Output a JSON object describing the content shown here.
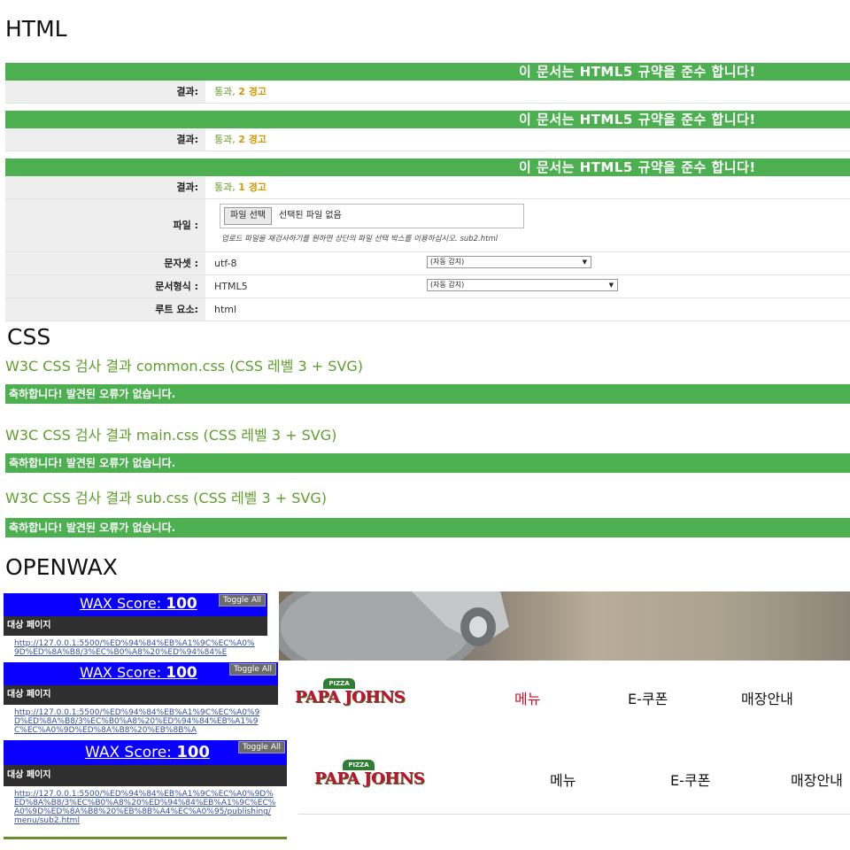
{
  "sections": {
    "html": "HTML",
    "css": "CSS",
    "openwax": "OPENWAX"
  },
  "html_validator": {
    "banner": "이 문서는 HTML5 규약을 준수 합니다!",
    "results": [
      {
        "label": "결과:",
        "pass": "통과,",
        "warn": "2 경고"
      },
      {
        "label": "결과:",
        "pass": "통과,",
        "warn": "2 경고"
      },
      {
        "label": "결과:",
        "pass": "통과,",
        "warn": "1 경고"
      }
    ],
    "file": {
      "label": "파일 :",
      "button": "파일 선택",
      "none": "선택된 파일 없음",
      "hint": "업로드 파일을 재검사하기를 원하면 상단의 파일 선택 박스를 이용하십시오. sub2.html"
    },
    "charset": {
      "label": "문자셋 :",
      "value": "utf-8",
      "select": "(자동 감지)"
    },
    "doctype": {
      "label": "문서형식 :",
      "value": "HTML5",
      "select": "(자동 감지)"
    },
    "root": {
      "label": "루트 요소:",
      "value": "html"
    }
  },
  "css_validator": {
    "results": [
      {
        "title": "W3C CSS 검사 결과 common.css (CSS 레벨 3 + SVG)",
        "message": "축하합니다! 발견된 오류가 없습니다."
      },
      {
        "title": "W3C CSS 검사 결과 main.css (CSS 레벨 3 + SVG)",
        "message": "축하합니다! 발견된 오류가 없습니다."
      },
      {
        "title": "W3C CSS 검사 결과 sub.css (CSS 레벨 3 + SVG)",
        "message": "축하합니다! 발견된 오류가 없습니다."
      }
    ]
  },
  "wax": {
    "score_label": "WAX Score:",
    "score": "100",
    "toggle": "Toggle All",
    "target_label": "대상 페이지",
    "urls": [
      "http://127.0.0.1:5500/%ED%94%84%EB%A1%9C%EC%A0%9D%ED%8A%B8/3%EC%B0%A8%20%ED%94%84%E",
      "http://127.0.0.1:5500/%ED%94%84%EB%A1%9C%EC%A0%9D%ED%8A%B8/3%EC%B0%A8%20%ED%94%84%EB%A1%9C%EC%A0%9D%ED%8A%B8%20%EB%8B%A",
      "http://127.0.0.1:5500/%ED%94%84%EB%A1%9C%EC%A0%9D%ED%8A%B8/3%EC%B0%A8%20%ED%94%84%EB%A1%9C%EC%A0%9D%ED%8A%B8%20%EB%8B%A4%EC%A0%95/publishing/menu/sub2.html"
    ]
  },
  "site": {
    "logo_cap": "PIZZA",
    "logo_text": "PAPA JOHNS",
    "nav": [
      "메뉴",
      "E-쿠폰",
      "매장안내"
    ]
  }
}
